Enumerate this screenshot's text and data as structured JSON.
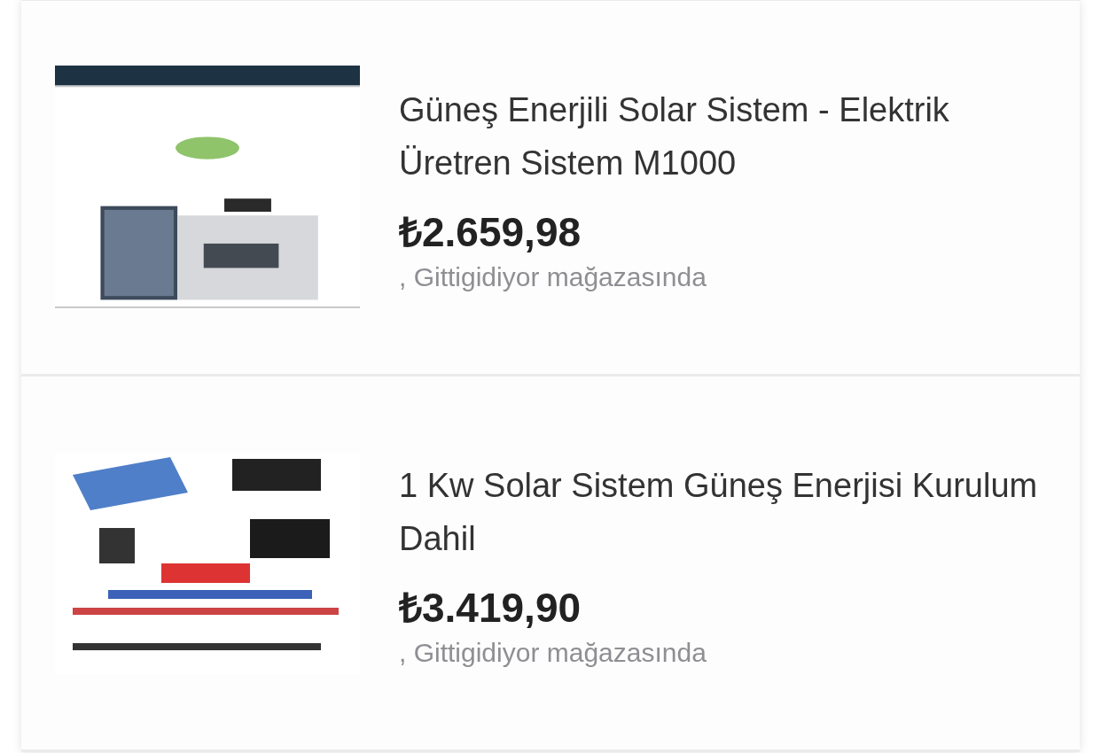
{
  "products": [
    {
      "title": "Güneş Enerjili Solar Sistem - Elektrik Üretren Sistem M1000",
      "price": "₺2.659,98",
      "store": ", Gittigidiyor mağazasında"
    },
    {
      "title": "1 Kw Solar Sistem Güneş Enerjisi Kurulum Dahil",
      "price": "₺3.419,90",
      "store": ", Gittigidiyor mağazasında"
    }
  ]
}
